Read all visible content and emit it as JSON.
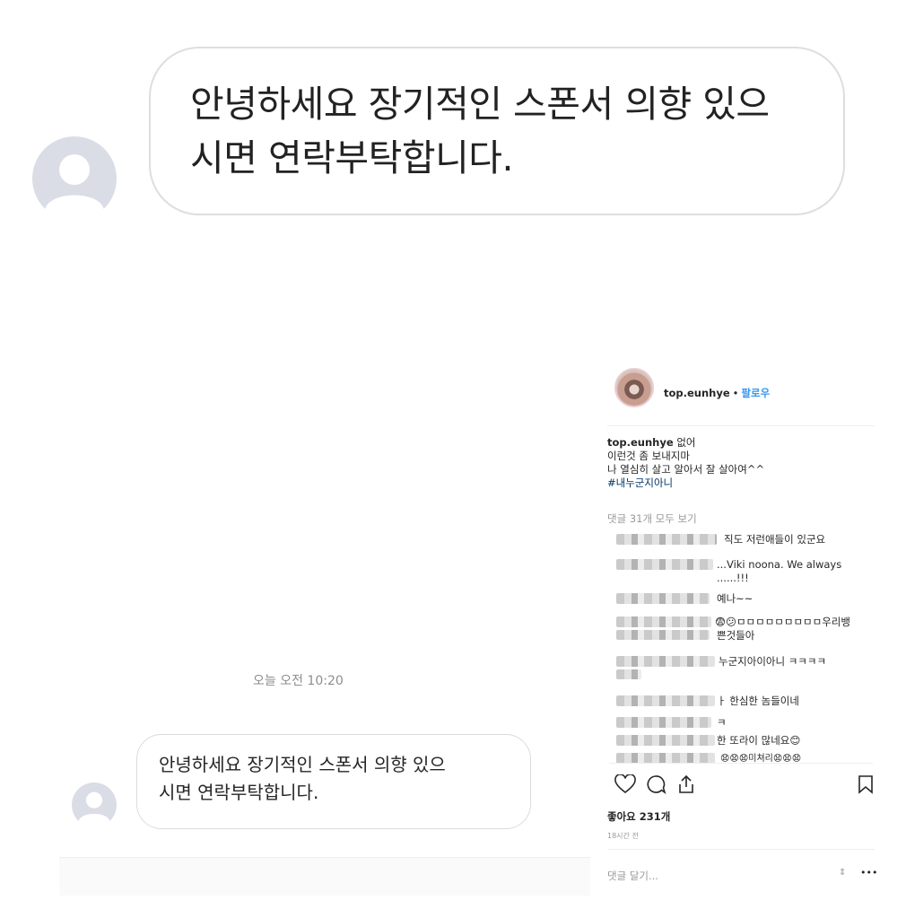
{
  "big_message": {
    "line1": "안녕하세요 장기적인 스폰서 의향 있으",
    "line2": "시면 연락부탁합니다."
  },
  "dm": {
    "timestamp": "오늘 오전 10:20",
    "message_line1": "안녕하세요 장기적인 스폰서 의향 있으",
    "message_line2": "시면 연락부탁합니다."
  },
  "instagram": {
    "username": "top.eunhye",
    "dot": "•",
    "follow": "팔로우",
    "caption": {
      "user": "top.eunhye",
      "line1": "없어",
      "line2": "이런것 좀 보내지마",
      "line3": "나 열심히 살고 알아서 잘 살아여^^",
      "hashtag": "#내누군지아니"
    },
    "view_comments": "댓글 31개 모두 보기",
    "comments": [
      "직도 저런애들이 있군요",
      "...Viki noona. We always",
      "......!!!",
      "예나~~",
      "😨😕ㅁㅁㅁㅁㅁㅁㅁㅁㅁ우리뱅",
      "쁜것들아",
      "누군지아이아니 ㅋㅋㅋㅋ",
      "ㅏ 한심한 놈들이네",
      "ㅋ",
      "한 또라이 많네요😊",
      "😧😧😧미쳐리😧😧😧"
    ],
    "likes": "좋아요 231개",
    "time": "18시간 전",
    "add_comment": "댓글 달기...",
    "more": "•••",
    "icons": [
      "heart-icon",
      "comment-icon",
      "share-icon",
      "bookmark-icon"
    ],
    "colors": {
      "follow": "#3897f0",
      "hashtag": "#003569"
    }
  }
}
